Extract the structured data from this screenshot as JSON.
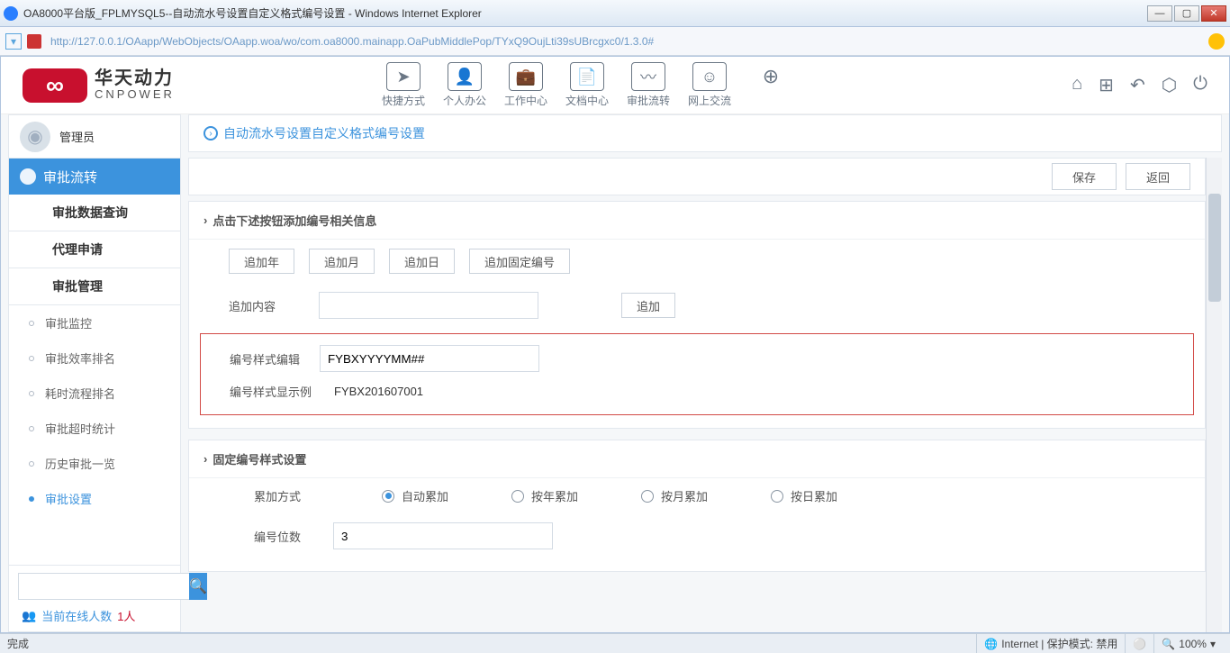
{
  "window": {
    "title": "OA8000平台版_FPLMYSQL5--自动流水号设置自定义格式编号设置 - Windows Internet Explorer",
    "url": "http://127.0.0.1/OAapp/WebObjects/OAapp.woa/wo/com.oa8000.mainapp.OaPubMiddlePop/TYxQ9OujLti39sUBrcgxc0/1.3.0#"
  },
  "logo": {
    "cn": "华天动力",
    "en": "CNPOWER"
  },
  "topnav": [
    {
      "label": "快捷方式",
      "icon": "➤"
    },
    {
      "label": "个人办公",
      "icon": "👤"
    },
    {
      "label": "工作中心",
      "icon": "💼"
    },
    {
      "label": "文档中心",
      "icon": "📄"
    },
    {
      "label": "审批流转",
      "icon": "〰"
    },
    {
      "label": "网上交流",
      "icon": "☺"
    }
  ],
  "toprightIcons": [
    "⌂",
    "⊞",
    "↶",
    "⬡",
    "⏻"
  ],
  "user": {
    "name": "管理员"
  },
  "sidebar": {
    "main": "审批流转",
    "groups": [
      "审批数据查询",
      "代理申请",
      "审批管理"
    ],
    "subs": [
      {
        "label": "审批监控",
        "active": false
      },
      {
        "label": "审批效率排名",
        "active": false
      },
      {
        "label": "耗时流程排名",
        "active": false
      },
      {
        "label": "审批超时统计",
        "active": false
      },
      {
        "label": "历史审批一览",
        "active": false
      },
      {
        "label": "审批设置",
        "active": true
      }
    ],
    "online": {
      "label": "当前在线人数",
      "count": "1人"
    },
    "searchPlaceholder": ""
  },
  "pageTitle": "自动流水号设置自定义格式编号设置",
  "buttons": {
    "save": "保存",
    "back": "返回"
  },
  "section1": {
    "title": "点击下述按钮添加编号相关信息",
    "addButtons": [
      "追加年",
      "追加月",
      "追加日",
      "追加固定编号"
    ],
    "addContent": {
      "label": "追加内容",
      "btn": "追加"
    },
    "formatEdit": {
      "label": "编号样式编辑",
      "value": "FYBXYYYYMM##"
    },
    "formatExample": {
      "label": "编号样式显示例",
      "value": "FYBX201607001"
    }
  },
  "section2": {
    "title": "固定编号样式设置",
    "accum": {
      "label": "累加方式",
      "options": [
        "自动累加",
        "按年累加",
        "按月累加",
        "按日累加"
      ],
      "selected": 0
    },
    "digits": {
      "label": "编号位数",
      "value": "3"
    }
  },
  "status": {
    "left": "完成",
    "zone": "Internet | 保护模式: 禁用",
    "zoom": "100%"
  }
}
